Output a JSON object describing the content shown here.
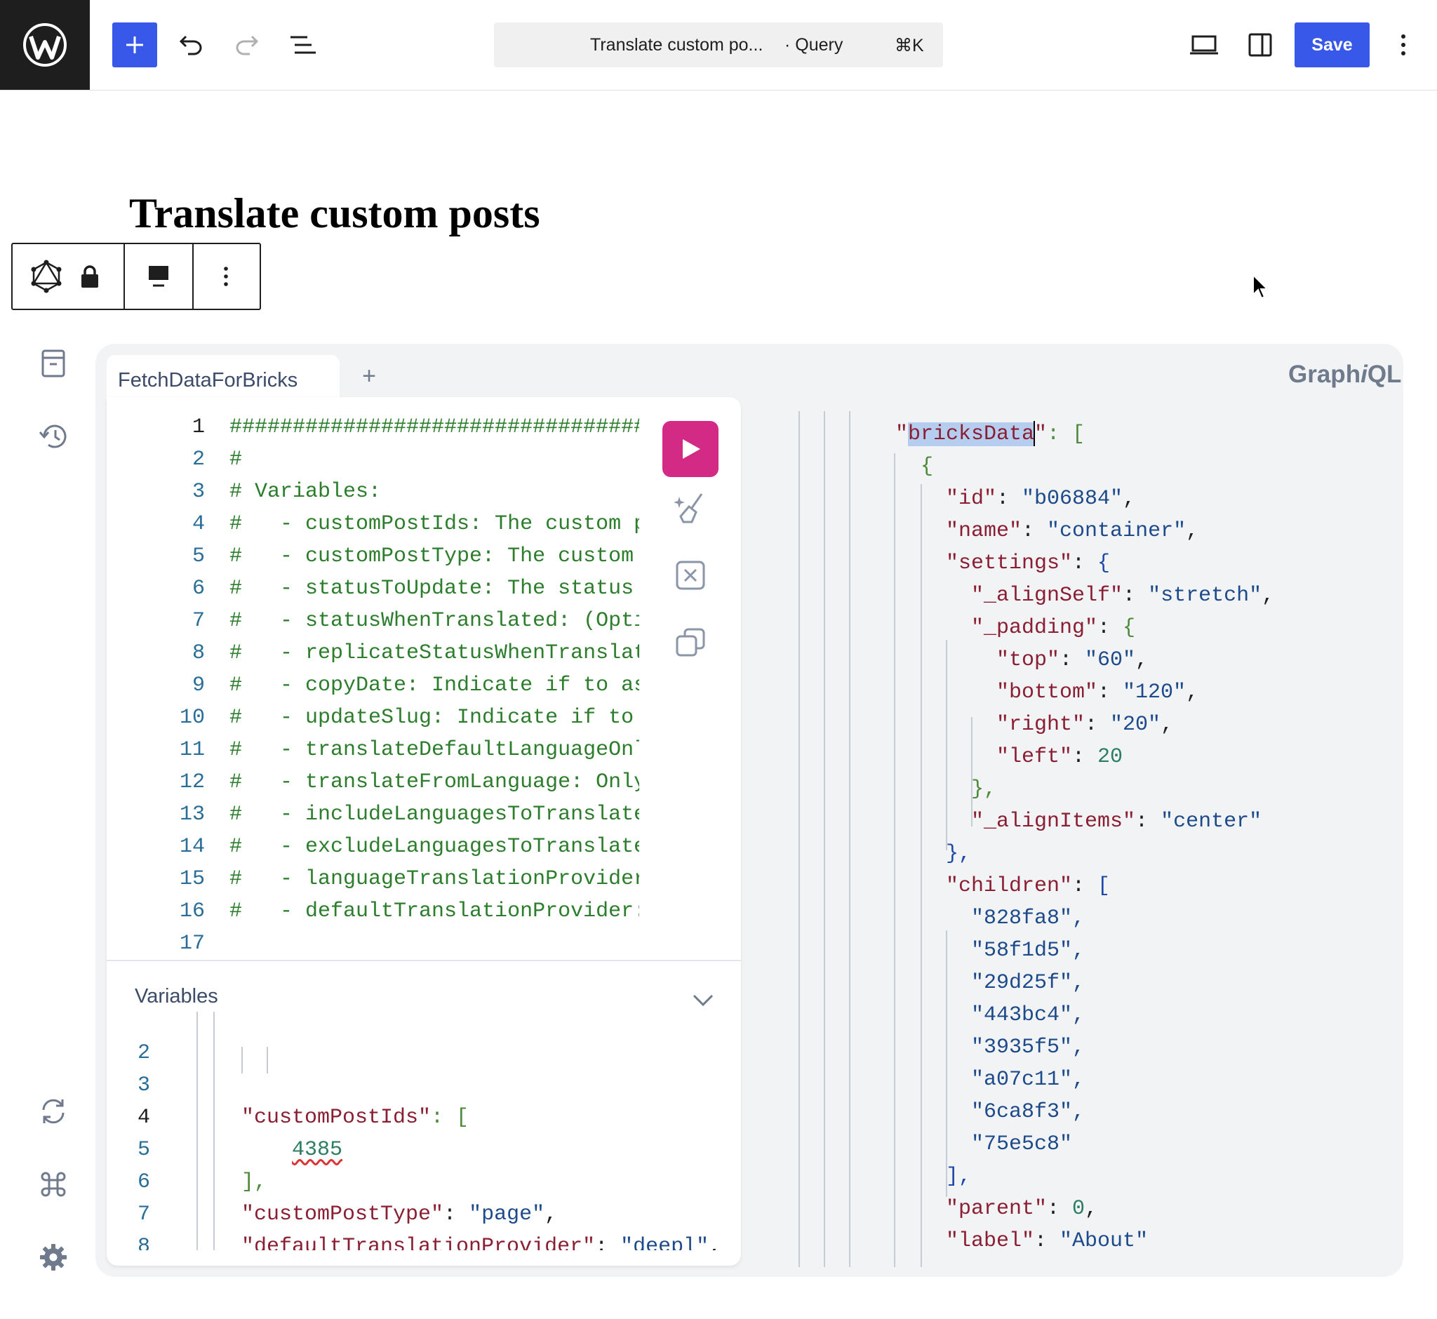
{
  "topbar": {
    "command_title": "Translate custom po...",
    "command_type": "· Query",
    "command_shortcut": "⌘K",
    "save_label": "Save"
  },
  "page": {
    "title": "Translate custom posts"
  },
  "graphiql": {
    "tab_label": "FetchDataForBricks",
    "tab_add": "+",
    "logo_prefix": "Graph",
    "logo_i": "i",
    "logo_suffix": "QL",
    "variables_title": "Variables",
    "query_lines": [
      {
        "n": "1",
        "t": "######################################"
      },
      {
        "n": "2",
        "t": "#"
      },
      {
        "n": "3",
        "t": "# Variables:"
      },
      {
        "n": "4",
        "t": "#   - customPostIds: The custom p"
      },
      {
        "n": "5",
        "t": "#   - customPostType: The custom "
      },
      {
        "n": "6",
        "t": "#   - statusToUpdate: The status "
      },
      {
        "n": "7",
        "t": "#   - statusWhenTranslated: (Opti"
      },
      {
        "n": "8",
        "t": "#   - replicateStatusWhenTranslat"
      },
      {
        "n": "9",
        "t": "#   - copyDate: Indicate if to as"
      },
      {
        "n": "10",
        "t": "#   - updateSlug: Indicate if to "
      },
      {
        "n": "11",
        "t": "#   - translateDefaultLanguageOnl"
      },
      {
        "n": "12",
        "t": "#   - translateFromLanguage: Only"
      },
      {
        "n": "13",
        "t": "#   - includeLanguagesToTranslate"
      },
      {
        "n": "14",
        "t": "#   - excludeLanguagesToTranslate"
      },
      {
        "n": "15",
        "t": "#   - languageTranslationProvider"
      },
      {
        "n": "16",
        "t": "#   - defaultTranslationProvider:"
      },
      {
        "n": "17",
        "t": ""
      }
    ],
    "variables_lines": {
      "n2": "2",
      "n3": "3",
      "n4": "4",
      "n5": "5",
      "n6": "6",
      "n7": "7",
      "n8": "8",
      "l3_key": "\"customPostIds\"",
      "l3_rest": ": [",
      "l4_val": "4385",
      "l5": "],",
      "l6_key": "\"customPostType\"",
      "l6_sep": ": ",
      "l6_val": "\"page\"",
      "l6_end": ",",
      "l7_key": "\"defaultTranslationProvider\"",
      "l7_sep": ": ",
      "l7_val": "\"deepl\"",
      "l7_end": ","
    },
    "result": {
      "bricks_q1": "\"",
      "bricks_key": "bricksData",
      "bricks_q2": "\"",
      "bricks_rest": ": [",
      "open_obj": "{",
      "id_key": "\"id\"",
      "id_val": "\"b06884\"",
      "name_key": "\"name\"",
      "name_val": "\"container\"",
      "settings_key": "\"settings\"",
      "alignself_key": "\"_alignSelf\"",
      "alignself_val": "\"stretch\"",
      "padding_key": "\"_padding\"",
      "top_key": "\"top\"",
      "top_val": "\"60\"",
      "bottom_key": "\"bottom\"",
      "bottom_val": "\"120\"",
      "right_key": "\"right\"",
      "right_val": "\"20\"",
      "left_key": "\"left\"",
      "left_val": "20",
      "close_padding": "},",
      "alignitems_key": "\"_alignItems\"",
      "alignitems_val": "\"center\"",
      "close_settings": "},",
      "children_key": "\"children\"",
      "children": [
        "\"828fa8\",",
        "\"58f1d5\",",
        "\"29d25f\",",
        "\"443bc4\",",
        "\"3935f5\",",
        "\"a07c11\",",
        "\"6ca8f3\",",
        "\"75e5c8\""
      ],
      "close_children": "],",
      "parent_key": "\"parent\"",
      "parent_val": "0",
      "label_key": "\"label\"",
      "label_val": "\"About\""
    }
  },
  "colors": {
    "admin_blue": "#3858e9",
    "run_button": "#d32a85",
    "wp_logo_bg": "#1e1e1e"
  }
}
